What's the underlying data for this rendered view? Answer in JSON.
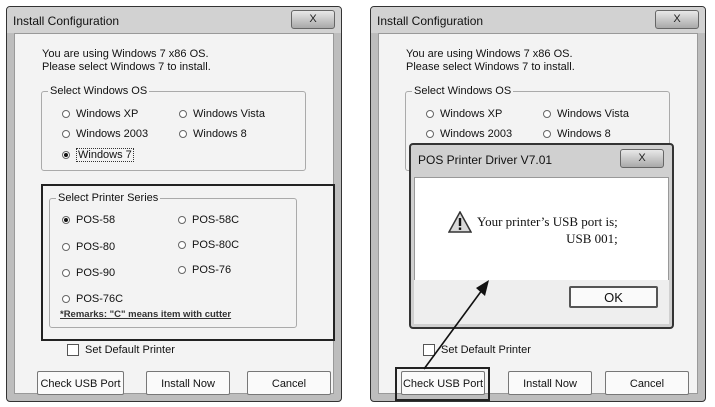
{
  "left_window": {
    "title": "Install Configuration",
    "close_label": "X",
    "info_line1": "You are using Windows 7 x86 OS.",
    "info_line2": "Please select Windows 7 to install.",
    "os_group": {
      "title": "Select Windows OS",
      "options": [
        "Windows XP",
        "Windows Vista",
        "Windows 2003",
        "Windows 8",
        "Windows 7"
      ],
      "selected": "Windows 7"
    },
    "printer_group": {
      "title": "Select Printer Series",
      "options": [
        "POS-58",
        "POS-58C",
        "POS-80",
        "POS-80C",
        "POS-90",
        "POS-76",
        "POS-76C"
      ],
      "selected": "POS-58",
      "remarks": "*Remarks: \"C\" means item with cutter"
    },
    "set_default_label": "Set Default Printer",
    "buttons": {
      "check_usb": "Check USB Port",
      "install": "Install Now",
      "cancel": "Cancel"
    }
  },
  "right_window": {
    "title": "Install Configuration",
    "close_label": "X",
    "info_line1": "You are using Windows 7 x86 OS.",
    "info_line2": "Please select Windows 7 to install.",
    "os_group": {
      "title": "Select Windows OS",
      "options": [
        "Windows XP",
        "Windows Vista",
        "Windows 2003",
        "Windows 8"
      ]
    },
    "set_default_label": "Set Default Printer",
    "buttons": {
      "check_usb": "Check USB Port",
      "install": "Install Now",
      "cancel": "Cancel"
    },
    "dialog": {
      "title": "POS Printer Driver V7.01",
      "close_label": "X",
      "message_line1": "Your printer’s USB port is;",
      "message_line2": "USB 001;",
      "ok_label": "OK",
      "icon": "warning-icon"
    }
  },
  "colors": {
    "frame": "#bdbdbd",
    "client": "#f3f3f3",
    "highlight_border": "#222222"
  }
}
